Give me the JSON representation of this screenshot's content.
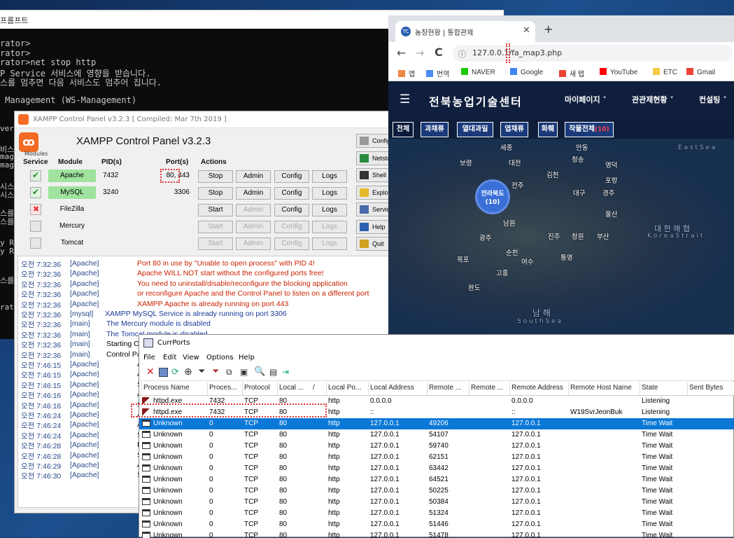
{
  "cmd": {
    "title": "프롬프트",
    "lines": [
      "rator>",
      "rator>",
      "rator>net stop http",
      "P Service 서비스에 영향을 받습니다.",
      "스를 멈추면 다음 서비스도 멈추어 집니다.",
      "",
      " Management (WS-Management)"
    ],
    "left_fragments": [
      "ver",
      "비스",
      "mag",
      "mag",
      "시스",
      "시스",
      "스를",
      "스를",
      "y R",
      "y R",
      "스를",
      "rat"
    ]
  },
  "xampp": {
    "window_title": "XAMPP Control Panel v3.2.3   [ Compiled: Mar 7th 2019 ]",
    "header_title": "XAMPP Control Panel v3.2.3",
    "col_modules_small": "Modules",
    "col_service": "Service",
    "col_module": "Module",
    "col_pid": "PID(s)",
    "col_ports": "Port(s)",
    "col_actions": "Actions",
    "modules": [
      {
        "name": "Apache",
        "pid": "7432",
        "port": "80, 443",
        "action": "Stop",
        "running": true,
        "status": "running"
      },
      {
        "name": "MySQL",
        "pid": "3240",
        "port": "3306",
        "action": "Stop",
        "running": true,
        "status": "running"
      },
      {
        "name": "FileZilla",
        "pid": "",
        "port": "",
        "action": "Start",
        "running": false,
        "status": "error"
      },
      {
        "name": "Mercury",
        "pid": "",
        "port": "",
        "action": "Start",
        "running": false,
        "status": "disabled"
      },
      {
        "name": "Tomcat",
        "pid": "",
        "port": "",
        "action": "Start",
        "running": false,
        "status": "disabled"
      }
    ],
    "btn_admin": "Admin",
    "btn_config": "Config",
    "btn_logs": "Logs",
    "side_buttons": [
      "Config",
      "Netstat",
      "Shell",
      "Explorer",
      "Services",
      "Help",
      "Quit"
    ],
    "log": [
      {
        "time": "오전 7:32:36",
        "mod": "[Apache]",
        "msg": "Port 80 in use by \"Unable to open process\" with PID 4!",
        "color": "#cc2200"
      },
      {
        "time": "오전 7:32:36",
        "mod": "[Apache]",
        "msg": "Apache WILL NOT start without the configured ports free!",
        "color": "#cc2200"
      },
      {
        "time": "오전 7:32:36",
        "mod": "[Apache]",
        "msg": "You need to uninstall/disable/reconfigure the blocking application",
        "color": "#cc2200"
      },
      {
        "time": "오전 7:32:36",
        "mod": "[Apache]",
        "msg": "or reconfigure Apache and the Control Panel to listen on a different port",
        "color": "#cc2200"
      },
      {
        "time": "오전 7:32:36",
        "mod": "[Apache]",
        "msg": "XAMPP Apache is already running on port 443",
        "color": "#cc2200"
      },
      {
        "time": "오전 7:32:36",
        "mod": "[mysql]",
        "msg": "XAMPP MySQL Service is already running on port 3306",
        "color": "#1a3a9a"
      },
      {
        "time": "오전 7:32:36",
        "mod": "[main]",
        "msg": "The Mercury module is disabled",
        "color": "#1a3a9a"
      },
      {
        "time": "오전 7:32:36",
        "mod": "[main]",
        "msg": "The Tomcat module is disabled",
        "color": "#1a3a9a"
      },
      {
        "time": "오전 7:32:36",
        "mod": "[main]",
        "msg": "Starting Check-Timer",
        "color": "#000000"
      },
      {
        "time": "오전 7:32:36",
        "mod": "[main]",
        "msg": "Control Panel Ready",
        "color": "#000000"
      },
      {
        "time": "오전 7:46:15",
        "mod": "[Apache]",
        "msg": "A",
        "color": "#000000"
      },
      {
        "time": "오전 7:46:15",
        "mod": "[Apache]",
        "msg": "A",
        "color": "#000000"
      },
      {
        "time": "오전 7:46:15",
        "mod": "[Apache]",
        "msg": "S",
        "color": "#000000"
      },
      {
        "time": "오전 7:46:16",
        "mod": "[Apache]",
        "msg": "A",
        "color": "#000000"
      },
      {
        "time": "오전 7:46:16",
        "mod": "[Apache]",
        "msg": "S",
        "color": "#000000"
      },
      {
        "time": "오전 7:46:24",
        "mod": "[Apache]",
        "msg": "A",
        "color": "#000000"
      },
      {
        "time": "오전 7:46:24",
        "mod": "[Apache]",
        "msg": "A",
        "color": "#000000"
      },
      {
        "time": "오전 7:46:24",
        "mod": "[Apache]",
        "msg": "S",
        "color": "#000000"
      },
      {
        "time": "오전 7:46:28",
        "mod": "[Apache]",
        "msg": "In",
        "color": "#000000"
      },
      {
        "time": "오전 7:46:28",
        "mod": "[Apache]",
        "msg": "S",
        "color": "#000000"
      },
      {
        "time": "오전 7:46:29",
        "mod": "[Apache]",
        "msg": "A",
        "color": "#000000"
      },
      {
        "time": "오전 7:46:30",
        "mod": "[Apache]",
        "msg": "S",
        "color": "#000000"
      }
    ]
  },
  "chrome": {
    "tab_title": "농장현황 | 통합관제",
    "tab_new": "+",
    "url": "127.0.0.1/fa_map3.php",
    "bookmarks": [
      "앱",
      "번역",
      "NAVER",
      "Google",
      "새 탭",
      "YouTube",
      "ETC",
      "Gmail"
    ],
    "site": {
      "brand": "전북농업기술센터",
      "nav": [
        "마이페이지 ˅",
        "관관제현황 ˅",
        "컨설팅 ˅"
      ],
      "filters": [
        {
          "label": "전체",
          "active": true
        },
        {
          "label": "과채류",
          "active": false
        },
        {
          "label": "열대과일",
          "active": false
        },
        {
          "label": "엽채류",
          "active": false
        },
        {
          "label": "화훼",
          "active": false
        },
        {
          "label": "작물전체",
          "count": "(10)",
          "active": false
        }
      ],
      "cluster": {
        "label": "전라북도",
        "count": "(10)"
      },
      "cities": [
        "세종",
        "안동",
        "대전",
        "보령",
        "김천",
        "포항",
        "대구",
        "경주",
        "전주",
        "울산",
        "남원",
        "광주",
        "진주",
        "창원",
        "부산",
        "목포",
        "순천",
        "여수",
        "통영",
        "완도",
        "고흥",
        "영덕",
        "청송"
      ],
      "sea_labels": [
        "E a s t  S e a",
        "대 한 해 협",
        "K o r e a  S t r a i t",
        "남 해",
        "S o u t h  S e a"
      ]
    }
  },
  "currports": {
    "title": "CurrPorts",
    "menu": [
      "File",
      "Edit",
      "View",
      "Options",
      "Help"
    ],
    "columns": [
      "Process Name",
      "Proces...",
      "Protocol",
      "Local ...",
      "/",
      "Local Po...",
      "Local Address",
      "Remote ...",
      "Remote ...",
      "Remote Address",
      "Remote Host Name",
      "State",
      "Sent Bytes"
    ],
    "rows": [
      {
        "proc": "httpd.exe",
        "pid": "7432",
        "proto": "TCP",
        "lport": "80",
        "lpname": "http",
        "laddr": "0.0.0.0",
        "rport": "",
        "rpname": "",
        "raddr": "0.0.0.0",
        "rhost": "",
        "state": "Listening",
        "icon": "feather",
        "sel": false
      },
      {
        "proc": "httpd.exe",
        "pid": "7432",
        "proto": "TCP",
        "lport": "80",
        "lpname": "http",
        "laddr": "::",
        "rport": "",
        "rpname": "",
        "raddr": "::",
        "rhost": "W19SvrJeonBuk",
        "state": "Listening",
        "icon": "feather",
        "sel": false
      },
      {
        "proc": "Unknown",
        "pid": "0",
        "proto": "TCP",
        "lport": "80",
        "lpname": "http",
        "laddr": "127.0.0.1",
        "rport": "49206",
        "rpname": "",
        "raddr": "127.0.0.1",
        "rhost": "",
        "state": "Time Wait",
        "icon": "window",
        "sel": true
      },
      {
        "proc": "Unknown",
        "pid": "0",
        "proto": "TCP",
        "lport": "80",
        "lpname": "http",
        "laddr": "127.0.0.1",
        "rport": "54107",
        "rpname": "",
        "raddr": "127.0.0.1",
        "rhost": "",
        "state": "Time Wait",
        "icon": "window",
        "sel": false
      },
      {
        "proc": "Unknown",
        "pid": "0",
        "proto": "TCP",
        "lport": "80",
        "lpname": "http",
        "laddr": "127.0.0.1",
        "rport": "59740",
        "rpname": "",
        "raddr": "127.0.0.1",
        "rhost": "",
        "state": "Time Wait",
        "icon": "window",
        "sel": false
      },
      {
        "proc": "Unknown",
        "pid": "0",
        "proto": "TCP",
        "lport": "80",
        "lpname": "http",
        "laddr": "127.0.0.1",
        "rport": "62151",
        "rpname": "",
        "raddr": "127.0.0.1",
        "rhost": "",
        "state": "Time Wait",
        "icon": "window",
        "sel": false
      },
      {
        "proc": "Unknown",
        "pid": "0",
        "proto": "TCP",
        "lport": "80",
        "lpname": "http",
        "laddr": "127.0.0.1",
        "rport": "63442",
        "rpname": "",
        "raddr": "127.0.0.1",
        "rhost": "",
        "state": "Time Wait",
        "icon": "window",
        "sel": false
      },
      {
        "proc": "Unknown",
        "pid": "0",
        "proto": "TCP",
        "lport": "80",
        "lpname": "http",
        "laddr": "127.0.0.1",
        "rport": "64521",
        "rpname": "",
        "raddr": "127.0.0.1",
        "rhost": "",
        "state": "Time Wait",
        "icon": "window",
        "sel": false
      },
      {
        "proc": "Unknown",
        "pid": "0",
        "proto": "TCP",
        "lport": "80",
        "lpname": "http",
        "laddr": "127.0.0.1",
        "rport": "50225",
        "rpname": "",
        "raddr": "127.0.0.1",
        "rhost": "",
        "state": "Time Wait",
        "icon": "window",
        "sel": false
      },
      {
        "proc": "Unknown",
        "pid": "0",
        "proto": "TCP",
        "lport": "80",
        "lpname": "http",
        "laddr": "127.0.0.1",
        "rport": "50384",
        "rpname": "",
        "raddr": "127.0.0.1",
        "rhost": "",
        "state": "Time Wait",
        "icon": "window",
        "sel": false
      },
      {
        "proc": "Unknown",
        "pid": "0",
        "proto": "TCP",
        "lport": "80",
        "lpname": "http",
        "laddr": "127.0.0.1",
        "rport": "51324",
        "rpname": "",
        "raddr": "127.0.0.1",
        "rhost": "",
        "state": "Time Wait",
        "icon": "window",
        "sel": false
      },
      {
        "proc": "Unknown",
        "pid": "0",
        "proto": "TCP",
        "lport": "80",
        "lpname": "http",
        "laddr": "127.0.0.1",
        "rport": "51446",
        "rpname": "",
        "raddr": "127.0.0.1",
        "rhost": "",
        "state": "Time Wait",
        "icon": "window",
        "sel": false
      },
      {
        "proc": "Unknown",
        "pid": "0",
        "proto": "TCP",
        "lport": "80",
        "lpname": "http",
        "laddr": "127.0.0.1",
        "rport": "51478",
        "rpname": "",
        "raddr": "127.0.0.1",
        "rhost": "",
        "state": "Time Wait",
        "icon": "window",
        "sel": false
      }
    ]
  },
  "colors": {
    "accent_select": "#0a78d7",
    "xampp_orange": "#f36b24",
    "log_error": "#cc2200",
    "log_info": "#1a3a9a",
    "highlight_dotted": "#e03030"
  }
}
